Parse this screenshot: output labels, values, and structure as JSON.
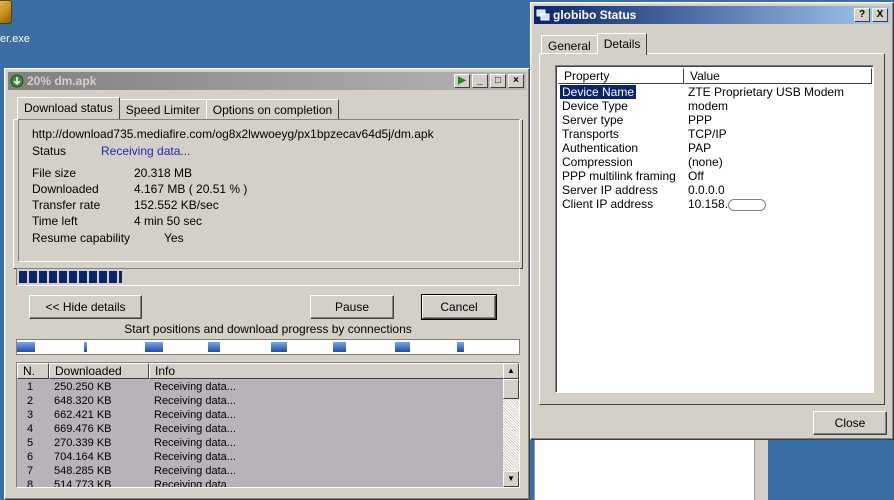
{
  "desktop": {
    "icon_label": "er.exe"
  },
  "download_window": {
    "title": "20% dm.apk",
    "tabs": [
      "Download status",
      "Speed Limiter",
      "Options on completion"
    ],
    "url": "http://download735.mediafire.com/og8x2lwwoeyg/px1bpzecav64d5j/dm.apk",
    "status_label": "Status",
    "status_value": "Receiving data...",
    "file_size_label": "File size",
    "file_size_value": "20.318  MB",
    "downloaded_label": "Downloaded",
    "downloaded_value": "4.167  MB  ( 20.51 % )",
    "transfer_rate_label": "Transfer rate",
    "transfer_rate_value": "152.552  KB/sec",
    "time_left_label": "Time left",
    "time_left_value": "4 min 50 sec",
    "resume_label": "Resume capability",
    "resume_value": "Yes",
    "progress_percent": 20.51,
    "hide_details_label": "<< Hide details",
    "pause_label": "Pause",
    "cancel_label": "Cancel",
    "connections_caption": "Start positions and download progress by connections",
    "columns": [
      "N.",
      "Downloaded",
      "Info"
    ],
    "connections": [
      {
        "n": "1",
        "downloaded": "250.250  KB",
        "info": "Receiving data..."
      },
      {
        "n": "2",
        "downloaded": "648.320  KB",
        "info": "Receiving data..."
      },
      {
        "n": "3",
        "downloaded": "662.421  KB",
        "info": "Receiving data..."
      },
      {
        "n": "4",
        "downloaded": "669.476  KB",
        "info": "Receiving data..."
      },
      {
        "n": "5",
        "downloaded": "270.339  KB",
        "info": "Receiving data..."
      },
      {
        "n": "6",
        "downloaded": "704.164  KB",
        "info": "Receiving data..."
      },
      {
        "n": "7",
        "downloaded": "548.285  KB",
        "info": "Receiving data..."
      },
      {
        "n": "8",
        "downloaded": "514.773  KB",
        "info": "Receiving data..."
      }
    ]
  },
  "status_window": {
    "title": "globibo Status",
    "help_btn": "?",
    "close_btn": "X",
    "tabs": [
      "General",
      "Details"
    ],
    "columns": [
      "Property",
      "Value"
    ],
    "rows": [
      {
        "property": "Device Name",
        "value": "ZTE Proprietary USB Modem"
      },
      {
        "property": "Device Type",
        "value": "modem"
      },
      {
        "property": "Server type",
        "value": "PPP"
      },
      {
        "property": "Transports",
        "value": "TCP/IP"
      },
      {
        "property": "Authentication",
        "value": "PAP"
      },
      {
        "property": "Compression",
        "value": "(none)"
      },
      {
        "property": "PPP multilink framing",
        "value": "Off"
      },
      {
        "property": "Server IP address",
        "value": "0.0.0.0"
      },
      {
        "property": "Client IP address",
        "value": "10.158."
      }
    ],
    "close_label": "Close"
  },
  "colors": {
    "desktop": "#3a6ea5",
    "window_face": "#d4d0c8",
    "active_title": "#0a246a",
    "link_blue": "#1b2bb0",
    "list_bg": "#b9b2bb"
  }
}
